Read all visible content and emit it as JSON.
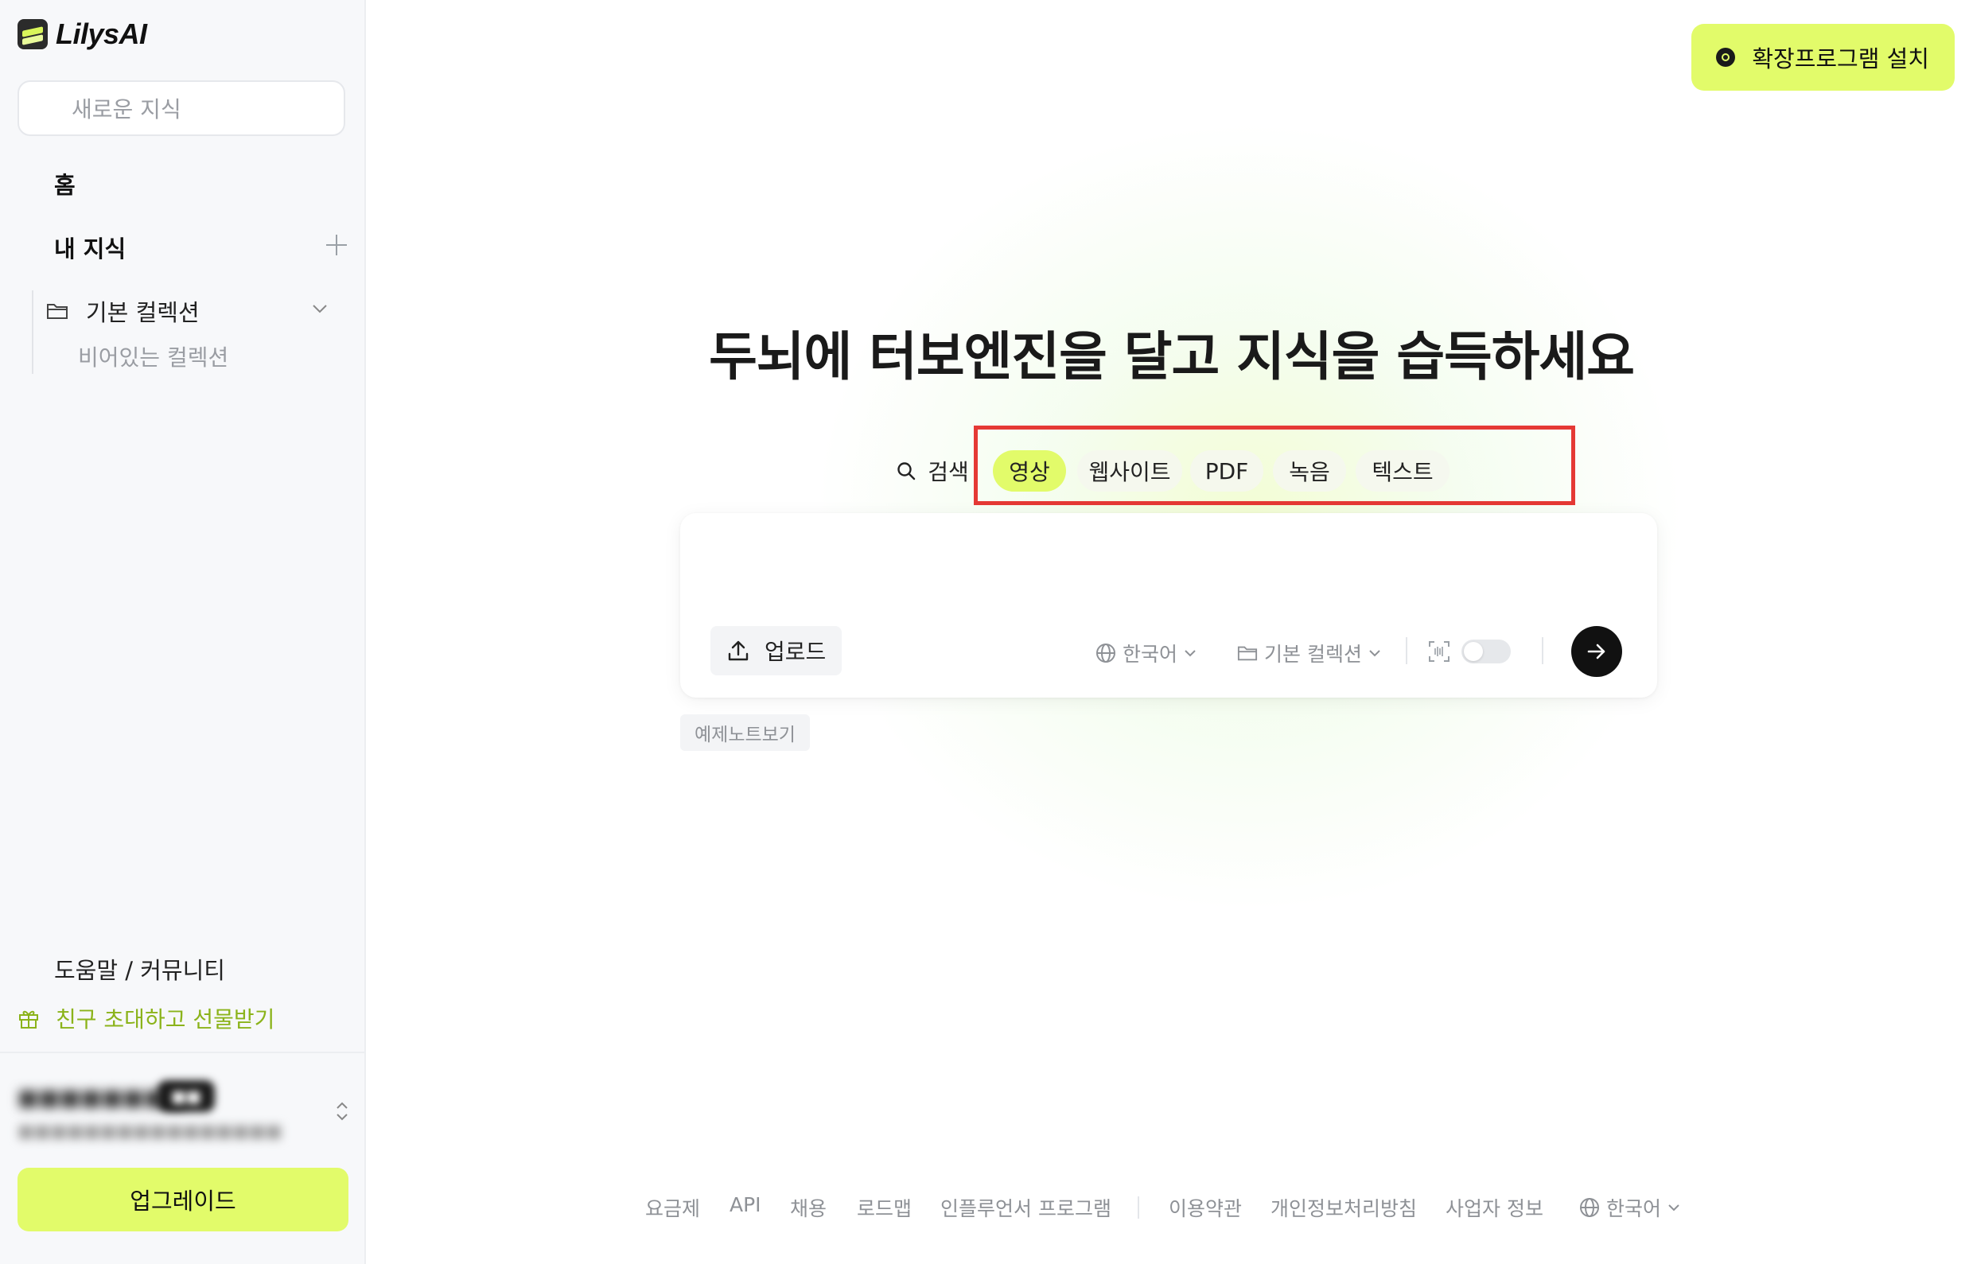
{
  "app": {
    "logo_text": "LilysAI"
  },
  "sidebar": {
    "new_knowledge_placeholder": "새로운 지식",
    "nav_home": "홈",
    "nav_my_knowledge": "내 지식",
    "collection_name": "기본 컬렉션",
    "collection_empty": "비어있는 컬렉션",
    "help_community": "도움말 / 커뮤니티",
    "invite": "친구 초대하고 선물받기",
    "upgrade": "업그레이드"
  },
  "header": {
    "install_extension": "확장프로그램 설치"
  },
  "hero": {
    "title": "두뇌에 터보엔진을 달고 지식을 습득하세요"
  },
  "tabs": {
    "search": "검색",
    "video": "영상",
    "website": "웹사이트",
    "pdf": "PDF",
    "recording": "녹음",
    "text": "텍스트",
    "selected": "영상"
  },
  "input_card": {
    "upload": "업로드",
    "language": "한국어",
    "collection": "기본 컬렉션",
    "toggle_on": false
  },
  "example_note": "예제노트보기",
  "footer": {
    "pricing": "요금제",
    "api": "API",
    "careers": "채용",
    "roadmap": "로드맵",
    "influencer": "인플루언서 프로그램",
    "terms": "이용약관",
    "privacy": "개인정보처리방침",
    "business_info": "사업자 정보",
    "language": "한국어"
  },
  "colors": {
    "accent": "#e2fb6a",
    "invite_text": "#8bb31a",
    "highlight_border": "#e53935"
  },
  "icons": [
    "search-icon",
    "folder-icon",
    "chevron-down-icon",
    "plus-icon",
    "gift-icon",
    "chrome-icon",
    "upload-icon",
    "globe-icon",
    "scan-icon",
    "arrow-right-icon",
    "updown-icon"
  ]
}
